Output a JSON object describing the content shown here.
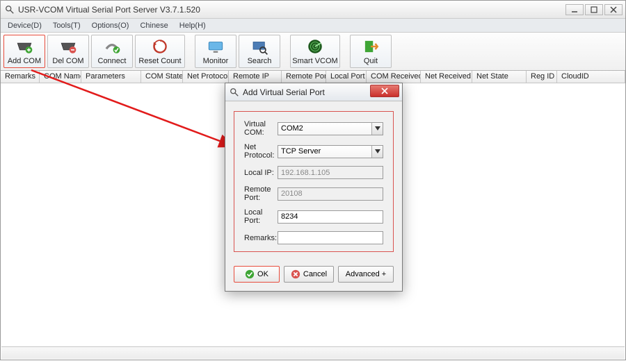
{
  "window": {
    "title": "USR-VCOM Virtual Serial Port Server V3.7.1.520"
  },
  "menu": {
    "device": "Device(D)",
    "tools": "Tools(T)",
    "options": "Options(O)",
    "chinese": "Chinese",
    "help": "Help(H)"
  },
  "toolbar": {
    "add_com": "Add COM",
    "del_com": "Del COM",
    "connect": "Connect",
    "reset_count": "Reset Count",
    "monitor": "Monitor",
    "search": "Search",
    "smart_vcom": "Smart VCOM",
    "quit": "Quit"
  },
  "columns": {
    "remarks": "Remarks",
    "com_name": "COM Name",
    "parameters": "Parameters",
    "com_state": "COM State",
    "net_protocol": "Net Protocol",
    "remote_ip": "Remote IP",
    "remote_port": "Remote Port",
    "local_port": "Local Port",
    "com_received": "COM Received",
    "net_received": "Net Received",
    "net_state": "Net State",
    "reg_id": "Reg ID",
    "cloud_id": "CloudID"
  },
  "dialog": {
    "title": "Add Virtual Serial Port",
    "labels": {
      "virtual_com": "Virtual COM:",
      "net_protocol": "Net Protocol:",
      "local_ip": "Local IP:",
      "remote_port": "Remote Port:",
      "local_port": "Local Port:",
      "remarks": "Remarks:"
    },
    "values": {
      "virtual_com": "COM2",
      "net_protocol": "TCP Server",
      "local_ip": "192.168.1.105",
      "remote_port": "20108",
      "local_port": "8234",
      "remarks": ""
    },
    "buttons": {
      "ok": "OK",
      "cancel": "Cancel",
      "advanced": "Advanced +"
    }
  }
}
